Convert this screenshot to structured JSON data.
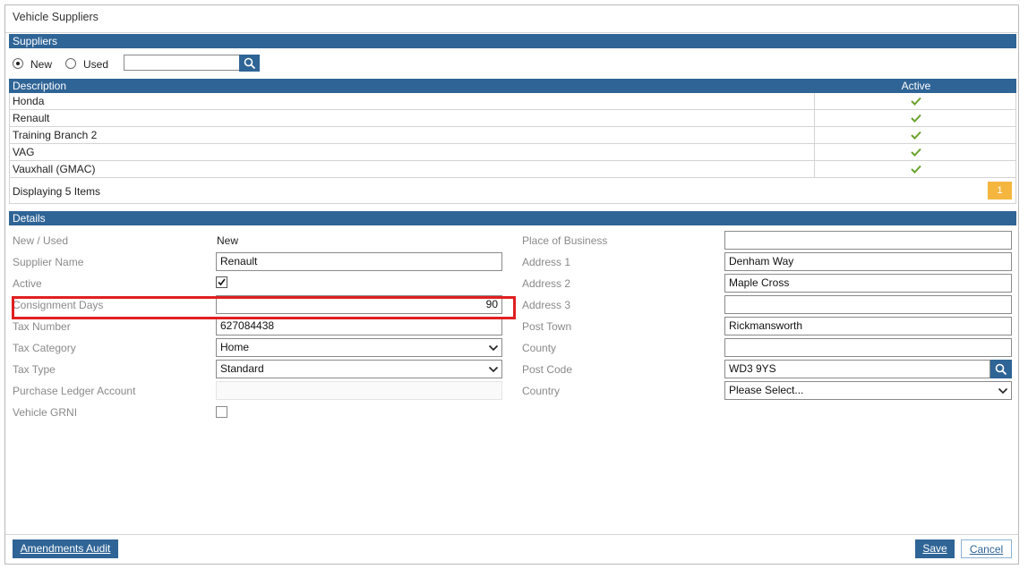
{
  "window": {
    "title": "Vehicle Suppliers"
  },
  "suppliers": {
    "section_title": "Suppliers",
    "filter": {
      "new_label": "New",
      "used_label": "Used",
      "selected": "New",
      "search_value": ""
    },
    "columns": {
      "description": "Description",
      "active": "Active"
    },
    "rows": [
      {
        "description": "Honda",
        "active": true
      },
      {
        "description": "Renault",
        "active": true
      },
      {
        "description": "Training Branch 2",
        "active": true
      },
      {
        "description": "VAG",
        "active": true
      },
      {
        "description": "Vauxhall (GMAC)",
        "active": true
      }
    ],
    "pager": {
      "summary": "Displaying 5 Items",
      "current_page": "1"
    }
  },
  "details": {
    "section_title": "Details",
    "left": {
      "new_used": {
        "label": "New / Used",
        "value": "New"
      },
      "supplier_name": {
        "label": "Supplier Name",
        "value": "Renault"
      },
      "active": {
        "label": "Active",
        "checked": true
      },
      "consignment_days": {
        "label": "Consignment Days",
        "value": "90"
      },
      "tax_number": {
        "label": "Tax Number",
        "value": "627084438"
      },
      "tax_category": {
        "label": "Tax Category",
        "value": "Home"
      },
      "tax_type": {
        "label": "Tax Type",
        "value": "Standard"
      },
      "purchase_ledger_account": {
        "label": "Purchase Ledger Account",
        "value": ""
      },
      "vehicle_grni": {
        "label": "Vehicle GRNI",
        "checked": false
      }
    },
    "right": {
      "place_of_business": {
        "label": "Place of Business",
        "value": ""
      },
      "address1": {
        "label": "Address 1",
        "value": "Denham Way"
      },
      "address2": {
        "label": "Address 2",
        "value": "Maple Cross"
      },
      "address3": {
        "label": "Address 3",
        "value": ""
      },
      "post_town": {
        "label": "Post Town",
        "value": "Rickmansworth"
      },
      "county": {
        "label": "County",
        "value": ""
      },
      "post_code": {
        "label": "Post Code",
        "value": "WD3 9YS"
      },
      "country": {
        "label": "Country",
        "value": "Please Select..."
      }
    }
  },
  "footer": {
    "amendments_audit": "Amendments Audit",
    "save": "Save",
    "cancel": "Cancel"
  },
  "colors": {
    "header_blue": "#2f6496",
    "check_green": "#6aa12b",
    "pager_orange": "#f5b640",
    "highlight_red": "#e02020"
  }
}
